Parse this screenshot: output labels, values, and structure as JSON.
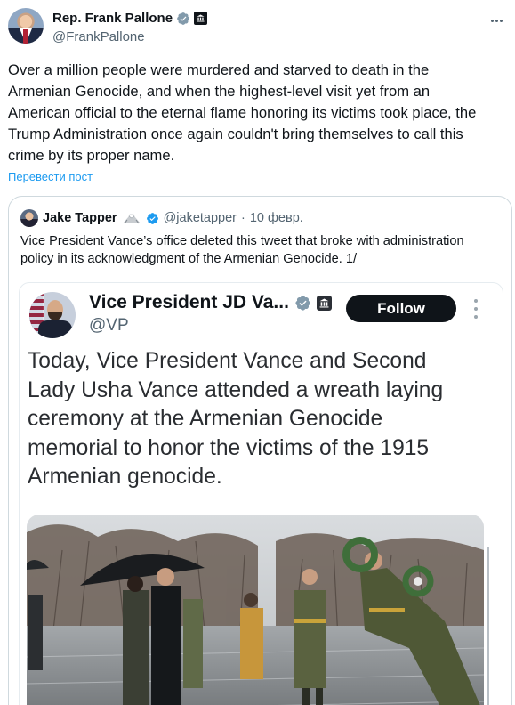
{
  "author": {
    "display_name": "Rep. Frank Pallone",
    "handle": "@FrankPallone"
  },
  "tweet": {
    "lines": [
      "Over a million people were murdered and starved to death in the",
      "Armenian Genocide, and when the highest-level visit yet from an",
      "American official to the eternal flame honoring its victims took place, the",
      "Trump Administration once again couldn't bring themselves to call this",
      "crime by its proper name."
    ],
    "translate_label": "Перевести пост"
  },
  "quote": {
    "display_name": "Jake Tapper",
    "handle": "@jaketapper",
    "separator": "·",
    "date": "10 февр.",
    "lines": [
      "Vice President Vance’s office deleted this tweet that broke with administration",
      "policy in its acknowledgment of the Armenian Genocide. 1/"
    ]
  },
  "embedded": {
    "display_name": "Vice President JD Va...",
    "handle": "@VP",
    "follow_label": "Follow",
    "lines": [
      "Today, Vice President Vance and Second",
      "Lady Usha Vance attended a wreath laying",
      "ceremony at the Armenian Genocide",
      "memorial to honor the victims of the 1915",
      "Armenian genocide."
    ]
  },
  "icons": {
    "verified": "verified-badge-icon",
    "government": "government-badge-icon",
    "more": "more-options-icon",
    "emoji": "volcano-emoji-icon"
  },
  "colors": {
    "accent": "#1d9bf0",
    "text": "#0f1419",
    "muted": "#536471",
    "border": "#cfd9de",
    "follow_bg": "#0f1419"
  }
}
